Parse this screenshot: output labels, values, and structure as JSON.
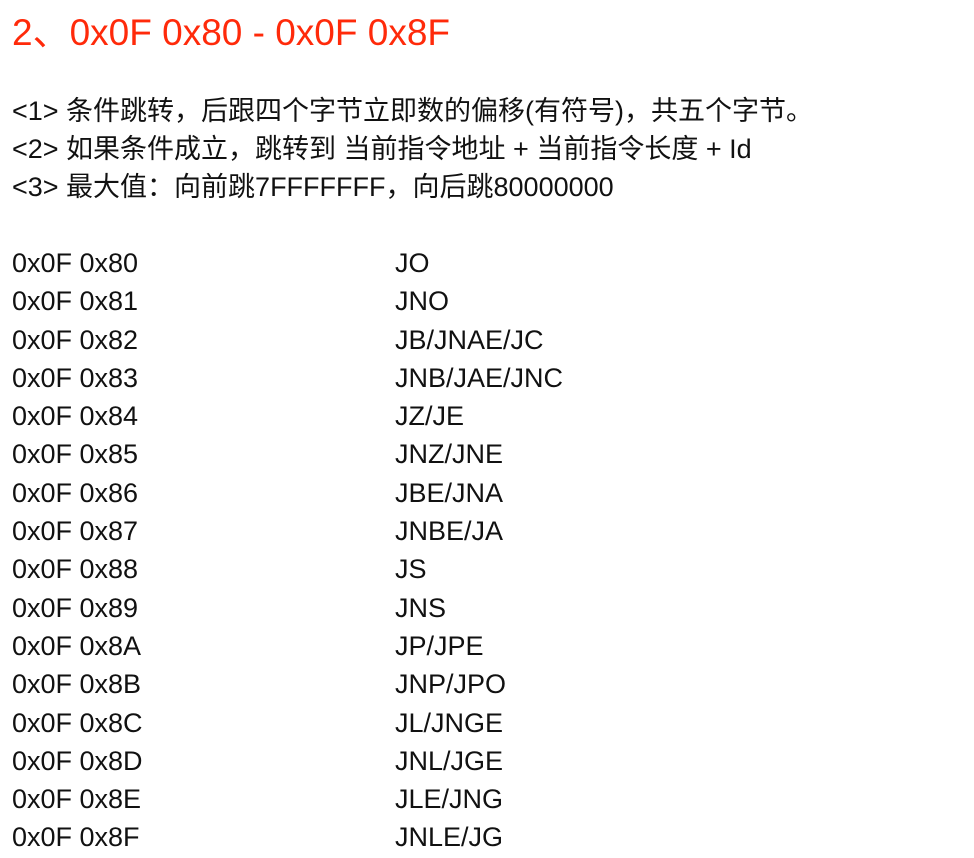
{
  "title": "2、0x0F 0x80 - 0x0F 0x8F",
  "title_color": "#ff2a0a",
  "notes": [
    "<1> 条件跳转，后跟四个字节立即数的偏移(有符号)，共五个字节。",
    "<2> 如果条件成立，跳转到 当前指令地址 + 当前指令长度 + Id",
    "<3> 最大值：向前跳7FFFFFFF，向后跳80000000"
  ],
  "rows": [
    {
      "code": "0x0F 0x80",
      "mnemonic": "JO"
    },
    {
      "code": "0x0F 0x81",
      "mnemonic": "JNO"
    },
    {
      "code": "0x0F 0x82",
      "mnemonic": "JB/JNAE/JC"
    },
    {
      "code": "0x0F 0x83",
      "mnemonic": "JNB/JAE/JNC"
    },
    {
      "code": "0x0F 0x84",
      "mnemonic": "JZ/JE"
    },
    {
      "code": "0x0F 0x85",
      "mnemonic": "JNZ/JNE"
    },
    {
      "code": "0x0F 0x86",
      "mnemonic": "JBE/JNA"
    },
    {
      "code": "0x0F 0x87",
      "mnemonic": "JNBE/JA"
    },
    {
      "code": "0x0F 0x88",
      "mnemonic": "JS"
    },
    {
      "code": "0x0F 0x89",
      "mnemonic": "JNS"
    },
    {
      "code": "0x0F 0x8A",
      "mnemonic": "JP/JPE"
    },
    {
      "code": "0x0F 0x8B",
      "mnemonic": "JNP/JPO"
    },
    {
      "code": "0x0F 0x8C",
      "mnemonic": "JL/JNGE"
    },
    {
      "code": "0x0F 0x8D",
      "mnemonic": "JNL/JGE"
    },
    {
      "code": "0x0F 0x8E",
      "mnemonic": "JLE/JNG"
    },
    {
      "code": "0x0F 0x8F",
      "mnemonic": "JNLE/JG"
    }
  ]
}
